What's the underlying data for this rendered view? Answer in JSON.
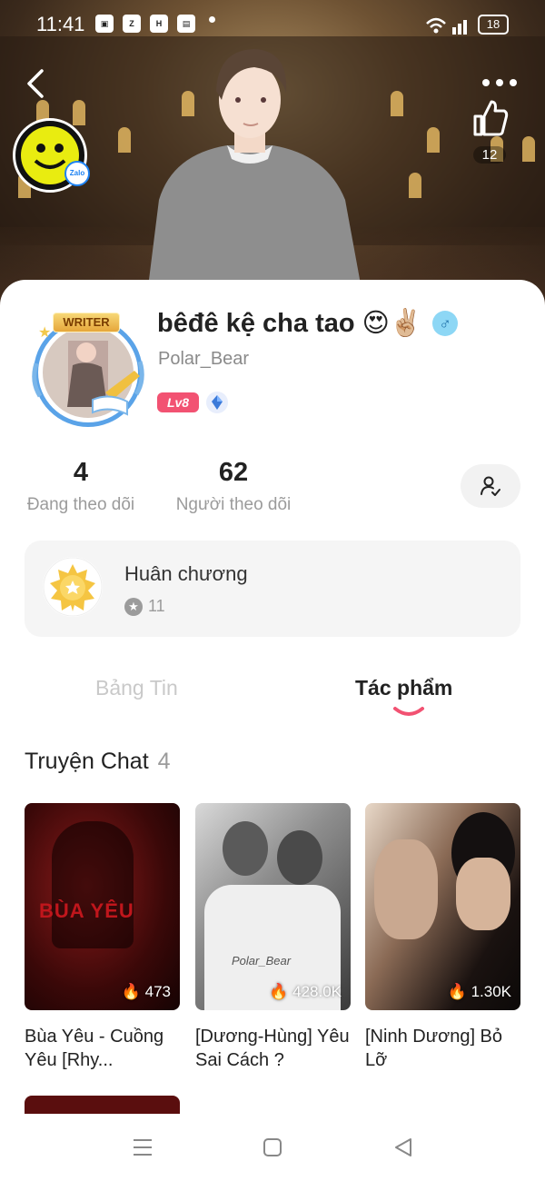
{
  "status_bar": {
    "time": "11:41",
    "battery": "18"
  },
  "header": {
    "like_count": "12",
    "zalo_badge": "Zalo"
  },
  "profile": {
    "name": "bêđê kệ cha tao 😍✌🏼",
    "gender_symbol": "♂",
    "username": "Polar_Bear",
    "level": "Lv8",
    "frame_tag": "WRITER"
  },
  "stats": {
    "following": {
      "count": "4",
      "label": "Đang theo dõi"
    },
    "followers": {
      "count": "62",
      "label": "Người theo dõi"
    }
  },
  "medals": {
    "title": "Huân chương",
    "count": "11"
  },
  "tabs": [
    {
      "label": "Bảng Tin",
      "active": false
    },
    {
      "label": "Tác phẩm",
      "active": true
    }
  ],
  "section": {
    "title": "Truyện Chat",
    "count": "4"
  },
  "stories": [
    {
      "title": "Bùa Yêu - Cuồng Yêu [Rhy...",
      "views": "473",
      "cover_text": "BÙA YÊU"
    },
    {
      "title": "[Dương-Hùng] Yêu Sai Cách ?",
      "views": "428.0K",
      "cover_sig": "Polar_Bear"
    },
    {
      "title": "[Ninh Dương] Bỏ Lỡ",
      "views": "1.30K"
    }
  ],
  "colors": {
    "accent": "#f25272",
    "text": "#222222",
    "muted": "#9b9b9b",
    "card_bg": "#f5f5f5"
  }
}
